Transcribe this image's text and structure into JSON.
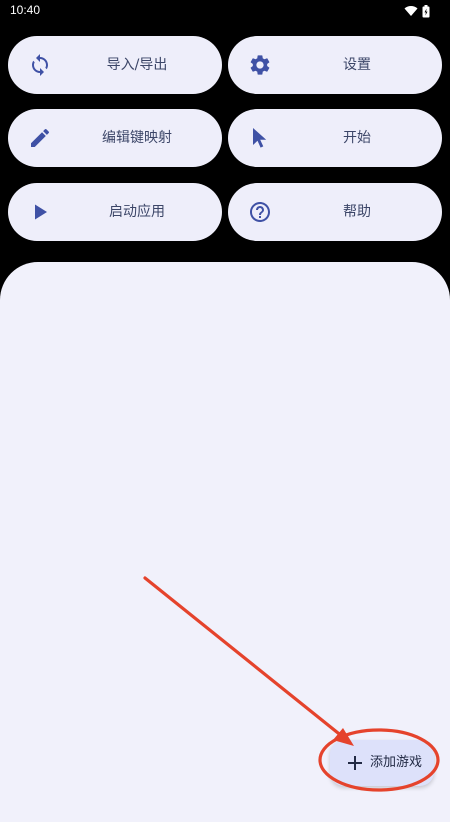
{
  "status_bar": {
    "time": "10:40"
  },
  "menu": {
    "buttons": [
      {
        "label": "导入/导出",
        "icon": "sync-icon"
      },
      {
        "label": "设置",
        "icon": "gear-icon"
      },
      {
        "label": "编辑键映射",
        "icon": "pencil-icon"
      },
      {
        "label": "开始",
        "icon": "cursor-pointer-icon"
      },
      {
        "label": "启动应用",
        "icon": "play-icon"
      },
      {
        "label": "帮助",
        "icon": "help-circle-icon"
      }
    ]
  },
  "fab": {
    "label": "添加游戏",
    "icon": "plus-icon"
  },
  "colors": {
    "background": "#000000",
    "button_bg": "#eeeefa",
    "panel_bg": "#f1f1fb",
    "icon": "#3f51a5",
    "fab_bg": "#dde1fa",
    "annotation_red": "#e5432c"
  }
}
